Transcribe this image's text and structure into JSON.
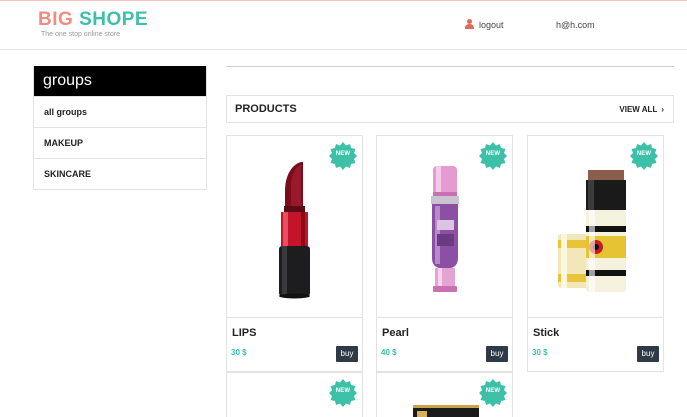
{
  "brand": {
    "title_part1": "BIG",
    "title_part2": "SHOPE",
    "tagline": "The one stop online store"
  },
  "header": {
    "logout_label": "logout",
    "user_email": "h@h.com"
  },
  "sidebar": {
    "heading": "groups",
    "items": [
      {
        "label": "all groups"
      },
      {
        "label": "MAKEUP"
      },
      {
        "label": "SKINCARE"
      }
    ]
  },
  "products": {
    "title": "PRODUCTS",
    "view_all": "VIEW ALL",
    "view_all_glyph": "›",
    "badge_label": "NEW",
    "items": [
      {
        "name": "LIPS",
        "price": "30 $",
        "buy": "buy"
      },
      {
        "name": "Pearl",
        "price": "40 $",
        "buy": "buy"
      },
      {
        "name": "Stick",
        "price": "30 $",
        "buy": "buy"
      }
    ]
  },
  "colors": {
    "brand_pink": "#f08c82",
    "brand_teal": "#3cc0a8",
    "badge": "#3cc0a8",
    "buy_button": "#2e3a46"
  }
}
